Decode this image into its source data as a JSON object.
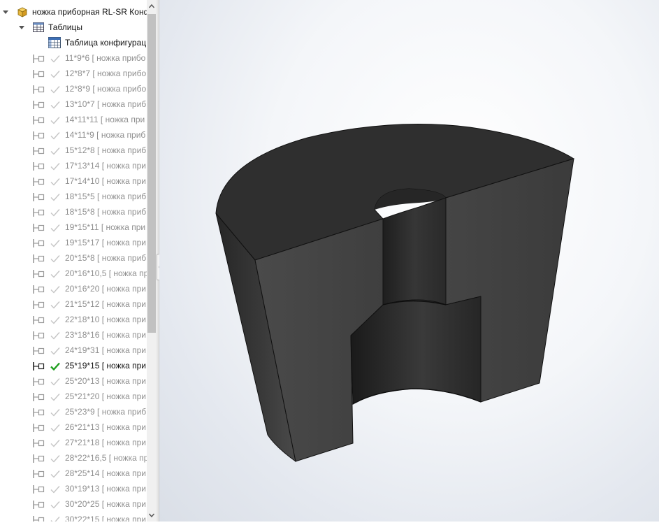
{
  "tree": {
    "root": {
      "label": "ножка приборная RL-SR Конф",
      "icon": "part-icon"
    },
    "tables_folder": {
      "label": "Таблицы",
      "icon": "table-folder-icon"
    },
    "config_table": {
      "label": "Таблица конфигурац",
      "icon": "design-table-icon"
    },
    "configurations": [
      {
        "label": "11*9*6 [ ножка прибо"
      },
      {
        "label": "12*8*7 [ ножка прибо"
      },
      {
        "label": "12*8*9 [ ножка прибо"
      },
      {
        "label": "13*10*7 [ ножка приб"
      },
      {
        "label": "14*11*11 [ ножка при"
      },
      {
        "label": "14*11*9 [ ножка приб"
      },
      {
        "label": "15*12*8 [ ножка приб"
      },
      {
        "label": "17*13*14 [ ножка при"
      },
      {
        "label": "17*14*10 [ ножка при"
      },
      {
        "label": "18*15*5 [ ножка приб"
      },
      {
        "label": "18*15*8 [ ножка приб"
      },
      {
        "label": "19*15*11 [ ножка при"
      },
      {
        "label": "19*15*17 [ ножка при"
      },
      {
        "label": "20*15*8 [ ножка приб"
      },
      {
        "label": "20*16*10,5 [ ножка пр"
      },
      {
        "label": "20*16*20 [ ножка при"
      },
      {
        "label": "21*15*12 [ ножка при"
      },
      {
        "label": "22*18*10 [ ножка при"
      },
      {
        "label": "23*18*16 [ ножка при"
      },
      {
        "label": "24*19*31 [ ножка при"
      },
      {
        "label": "25*19*15 [ ножка при",
        "active": true
      },
      {
        "label": "25*20*13 [ ножка при"
      },
      {
        "label": "25*21*20 [ ножка при"
      },
      {
        "label": "25*23*9 [ ножка приб"
      },
      {
        "label": "26*21*13 [ ножка при"
      },
      {
        "label": "27*21*18 [ ножка при"
      },
      {
        "label": "28*22*16,5 [ ножка пр"
      },
      {
        "label": "28*25*14 [ ножка при"
      },
      {
        "label": "30*19*13 [ ножка при"
      },
      {
        "label": "30*20*25 [ ножка при"
      },
      {
        "label": "30*22*15 [ ножка при"
      }
    ]
  },
  "colors": {
    "active_check": "#1e9e1e",
    "inactive_check": "#c4c4c4",
    "inactive_text": "#8f8f8f",
    "model_dark": "#303030"
  },
  "icons": {
    "scroll_up": "chevron-up-icon",
    "scroll_down": "chevron-down-icon",
    "splitter": "splitter-handle-icon",
    "config": "configuration-icon",
    "check": "check-icon"
  }
}
